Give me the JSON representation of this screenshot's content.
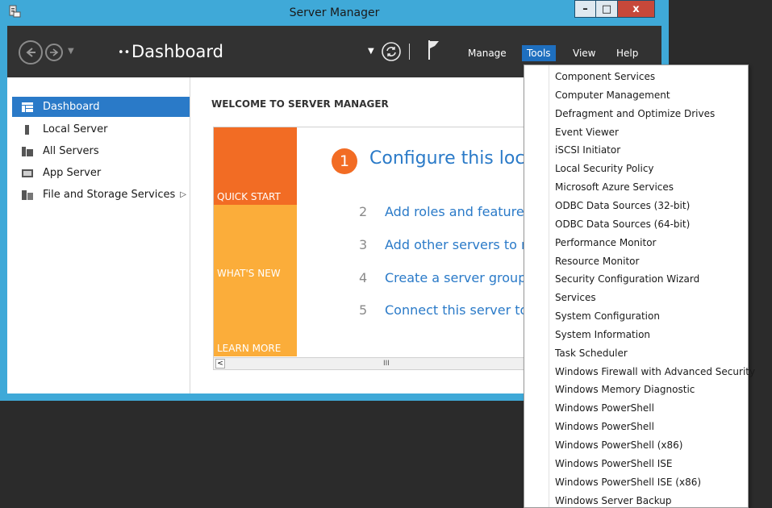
{
  "window": {
    "title": "Server Manager",
    "buttons": {
      "minimize": "–",
      "maximize": "□",
      "close": "x"
    }
  },
  "toolbar": {
    "breadcrumb_arrows": "••",
    "page_title": "Dashboard",
    "menus": {
      "manage": "Manage",
      "tools": "Tools",
      "view": "View",
      "help": "Help"
    }
  },
  "sidebar": {
    "items": [
      {
        "label": "Dashboard",
        "icon": "dashboard-icon"
      },
      {
        "label": "Local Server",
        "icon": "server-icon"
      },
      {
        "label": "All Servers",
        "icon": "servers-icon"
      },
      {
        "label": "App Server",
        "icon": "app-server-icon"
      },
      {
        "label": "File and Storage Services",
        "icon": "file-storage-icon"
      }
    ]
  },
  "main": {
    "welcome_title": "WELCOME TO SERVER MANAGER",
    "tiles": {
      "quick_start": "QUICK START",
      "whats_new": "WHAT'S NEW",
      "learn_more": "LEARN MORE"
    },
    "steps": [
      {
        "num": "1",
        "text": "Configure this local server"
      },
      {
        "num": "2",
        "text": "Add roles and features"
      },
      {
        "num": "3",
        "text": "Add other servers to manage"
      },
      {
        "num": "4",
        "text": "Create a server group"
      },
      {
        "num": "5",
        "text": "Connect this server to cloud services"
      }
    ],
    "scroll": {
      "left": "<",
      "thumb": "III"
    }
  },
  "tools_menu": {
    "items": [
      "Component Services",
      "Computer Management",
      "Defragment and Optimize Drives",
      "Event Viewer",
      "iSCSI Initiator",
      "Local Security Policy",
      "Microsoft Azure Services",
      "ODBC Data Sources (32-bit)",
      "ODBC Data Sources (64-bit)",
      "Performance Monitor",
      "Resource Monitor",
      "Security Configuration Wizard",
      "Services",
      "System Configuration",
      "System Information",
      "Task Scheduler",
      "Windows Firewall with Advanced Security",
      "Windows Memory Diagnostic",
      "Windows PowerShell",
      "Windows PowerShell",
      "Windows PowerShell (x86)",
      "Windows PowerShell ISE",
      "Windows PowerShell ISE (x86)",
      "Windows Server Backup"
    ]
  },
  "colors": {
    "frame": "#3fa9d8",
    "toolbar": "#323232",
    "accent": "#2a7ac8",
    "quick_start": "#f26c24",
    "tile": "#fbad3a"
  }
}
